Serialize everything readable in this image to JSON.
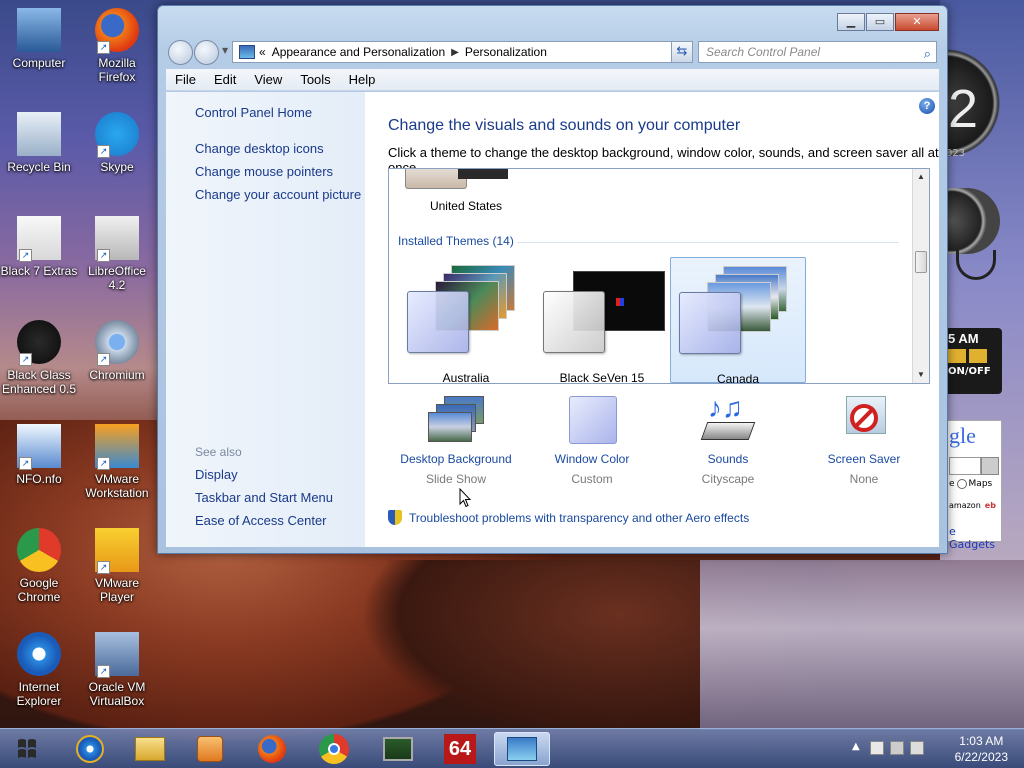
{
  "desktop": {
    "icons": [
      {
        "label": "Computer"
      },
      {
        "label": "Mozilla\nFirefox"
      },
      {
        "label": "Recycle Bin"
      },
      {
        "label": "Skype"
      },
      {
        "label": "Black 7 Extras"
      },
      {
        "label": "LibreOffice\n4.2"
      },
      {
        "label": "Black Glass\nEnhanced 0.5"
      },
      {
        "label": "Chromium"
      },
      {
        "label": "NFO.nfo"
      },
      {
        "label": "VMware\nWorkstation"
      },
      {
        "label": "Google\nChrome"
      },
      {
        "label": "VMware\nPlayer"
      },
      {
        "label": "Internet\nExplorer"
      },
      {
        "label": "Oracle VM\nVirtualBox"
      }
    ]
  },
  "window": {
    "breadcrumb": {
      "prefix": "«",
      "part1": "Appearance and Personalization",
      "part2": "Personalization"
    },
    "search_placeholder": "Search Control Panel",
    "menu": [
      "File",
      "Edit",
      "View",
      "Tools",
      "Help"
    ],
    "left": {
      "home": "Control Panel Home",
      "links": [
        "Change desktop icons",
        "Change mouse pointers",
        "Change your account picture"
      ],
      "see_also": "See also",
      "see_links": [
        "Display",
        "Taskbar and Start Menu",
        "Ease of Access Center"
      ]
    },
    "main": {
      "title": "Change the visuals and sounds on your computer",
      "subtitle": "Click a theme to change the desktop background, window color, sounds, and screen saver all at once.",
      "top_theme": "United States",
      "installed_header": "Installed Themes (14)",
      "themes": [
        {
          "name": "Australia",
          "selected": false
        },
        {
          "name": "Black SeVen 15",
          "selected": false
        },
        {
          "name": "Canada",
          "selected": true
        }
      ],
      "settings": [
        {
          "title": "Desktop Background",
          "value": "Slide Show",
          "icon": "desktop-background-icon"
        },
        {
          "title": "Window Color",
          "value": "Custom",
          "icon": "window-color-icon"
        },
        {
          "title": "Sounds",
          "value": "Cityscape",
          "icon": "sounds-icon"
        },
        {
          "title": "Screen Saver",
          "value": "None",
          "icon": "screen-saver-icon"
        }
      ],
      "troubleshoot": "Troubleshoot problems with transparency and other Aero effects",
      "help": "?"
    }
  },
  "gadgets": {
    "clock_time": "5 AM",
    "on_off": "ON/OFF",
    "google_text": "gle",
    "maps": "Maps",
    "gadgets_link": "e Gadgets",
    "amazon": "amazon",
    "ebay": "eb",
    "digit": "2",
    "year_frag": "023"
  },
  "taskbar": {
    "time": "1:03 AM",
    "date": "6/22/2023",
    "sixtyfour": "64"
  }
}
